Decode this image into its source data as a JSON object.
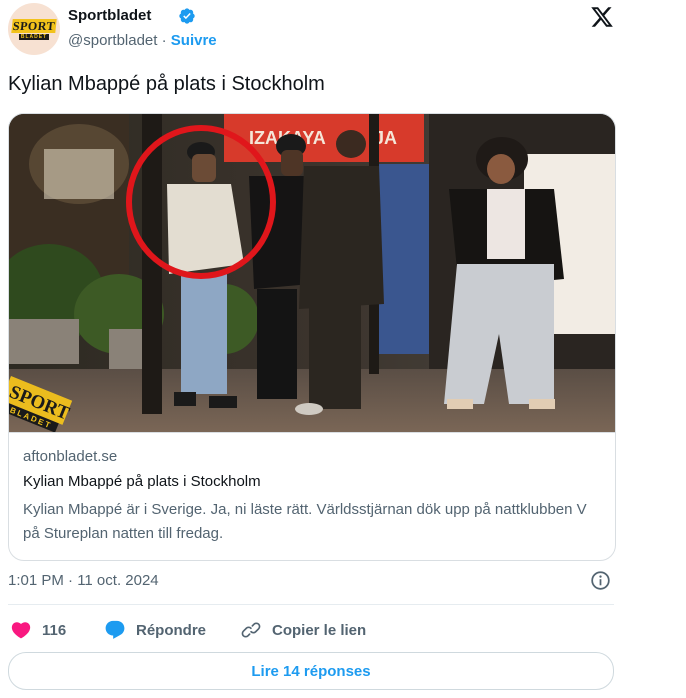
{
  "author": {
    "name": "Sportbladet",
    "handle": "@sportbladet",
    "separator": " · ",
    "follow_label": "Suivre",
    "avatar_text_top": "SPORT",
    "avatar_text_bottom": "BLADET"
  },
  "tweet": {
    "text": "Kylian Mbappé på plats i Stockholm",
    "timestamp": "1:01 PM · 11 oct. 2024"
  },
  "card": {
    "photo": {
      "sign_text": "IZAKAYA",
      "sign_text_2": "JA",
      "watermark_top": "SPORT",
      "watermark_bottom": "BLADET"
    },
    "domain": "aftonbladet.se",
    "title": "Kylian Mbappé på plats i Stockholm",
    "description": "Kylian Mbappé är i Sverige. Ja, ni läste rätt. Världsstjärnan dök upp på nattklubben V på Stureplan natten till fredag."
  },
  "actions": {
    "like_count": "116",
    "reply_label": "Répondre",
    "copy_label": "Copier le lien"
  },
  "read_replies_label": "Lire 14 réponses",
  "colors": {
    "accent": "#1d9bf0",
    "like": "#f91880",
    "highlight_circle": "#e0161b"
  }
}
